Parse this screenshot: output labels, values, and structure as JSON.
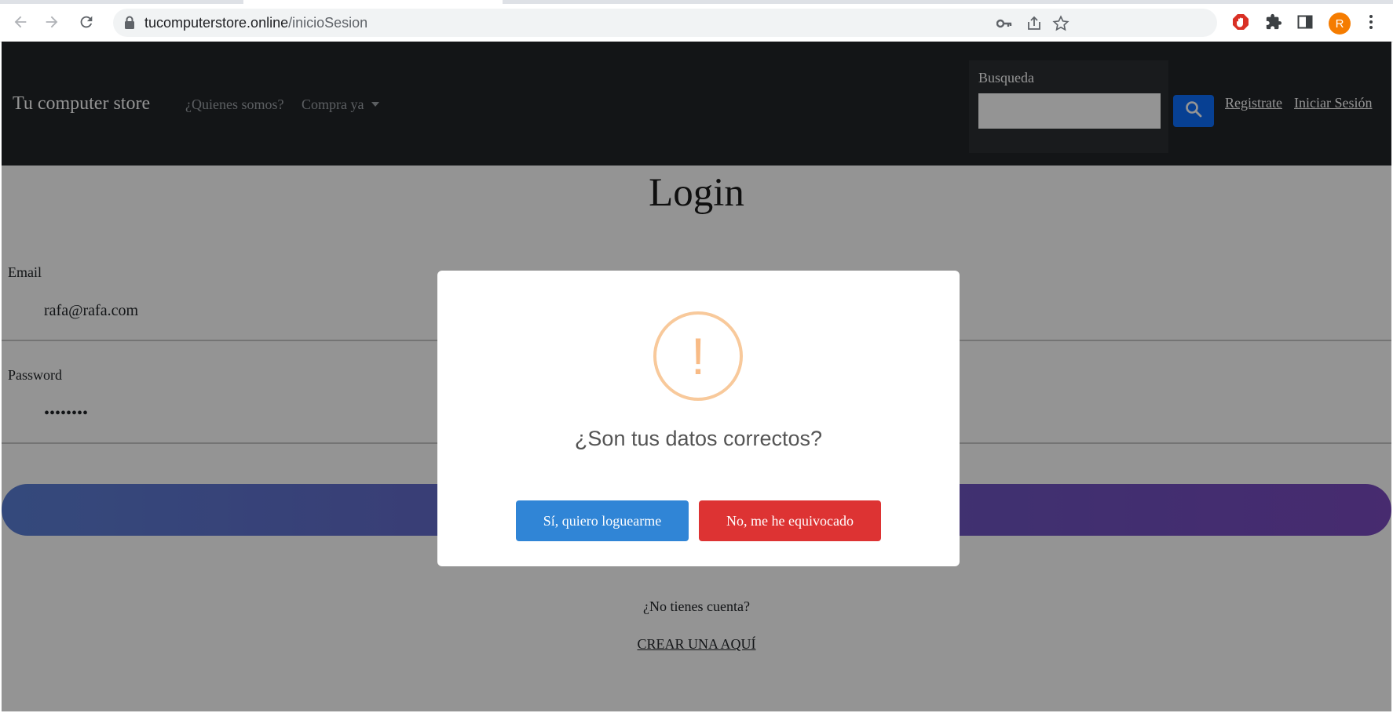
{
  "browser": {
    "url_host": "tucomputerstore.online",
    "url_path": "/inicioSesion",
    "profile_initial": "R"
  },
  "navbar": {
    "brand": "Tu computer store",
    "links": [
      "¿Quienes somos?",
      "Compra ya"
    ],
    "search_label": "Busqueda",
    "register": "Registrate",
    "login": "Iniciar Sesión"
  },
  "login": {
    "title": "Login",
    "email_label": "Email",
    "email_value": "rafa@rafa.com",
    "password_label": "Password",
    "password_value": "••••••••",
    "no_account": "¿No tienes cuenta?",
    "create_link": "CREAR UNA AQUÍ"
  },
  "modal": {
    "icon": "warning-icon",
    "icon_glyph": "!",
    "question": "¿Son tus datos correctos?",
    "confirm": "Sí, quiero loguearme",
    "cancel": "No, me he equivocado",
    "confirm_color": "#3085d6",
    "cancel_color": "#dd3333"
  }
}
